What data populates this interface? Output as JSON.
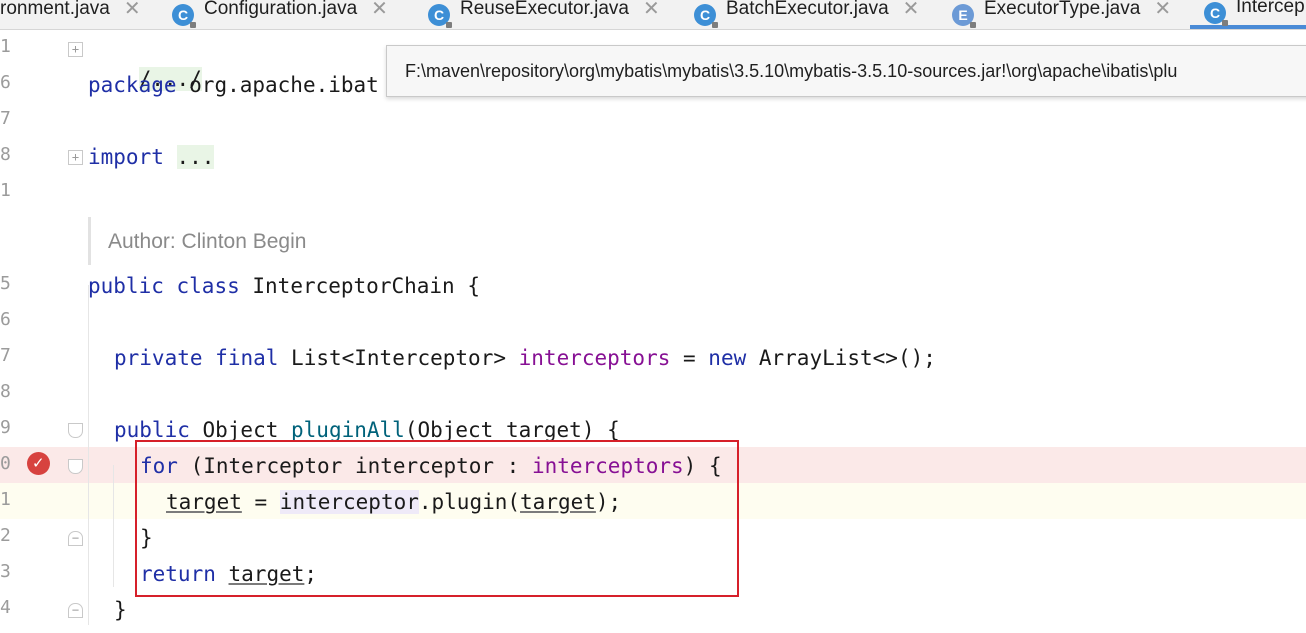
{
  "tabs": [
    {
      "badge": "",
      "label": "ronment.java",
      "active": false
    },
    {
      "badge": "C",
      "label": "Configuration.java",
      "active": false
    },
    {
      "badge": "C",
      "label": "ReuseExecutor.java",
      "active": false
    },
    {
      "badge": "C",
      "label": "BatchExecutor.java",
      "active": false
    },
    {
      "badge": "E",
      "label": "ExecutorType.java",
      "active": false
    },
    {
      "badge": "C",
      "label": "Intercep",
      "active": true
    }
  ],
  "close_glyph": "✕",
  "tooltip": {
    "path": "F:\\maven\\repository\\org\\mybatis\\mybatis\\3.5.10\\mybatis-3.5.10-sources.jar!\\org\\apache\\ibatis\\plu"
  },
  "line_numbers": [
    "1",
    "6",
    "7",
    "8",
    "1",
    "",
    "5",
    "6",
    "7",
    "8",
    "9",
    "0",
    "1",
    "2",
    "3",
    "4"
  ],
  "code": {
    "l1": "/.../",
    "l2_kw": "package",
    "l2_rest": " org.apache.ibat",
    "l4_kw": "import",
    "l4_rest": "...",
    "author": "Author: Clinton Begin",
    "l6_kw1": "public",
    "l6_kw2": "class",
    "l6_name": "InterceptorChain",
    "l6_brace": " {",
    "l8_kw1": "private",
    "l8_kw2": "final",
    "l8_type": "List<Interceptor>",
    "l8_field": "interceptors",
    "l8_eq": " = ",
    "l8_new": "new",
    "l8_rest": " ArrayList<>();",
    "l10_kw": "public",
    "l10_type": " Object ",
    "l10_meth": "pluginAll",
    "l10_rest": "(Object target) {",
    "l11_kw": "for",
    "l11_mid": " (Interceptor interceptor : ",
    "l11_field": "interceptors",
    "l11_end": ") {",
    "l12_var1": "target",
    "l12_eq": " = ",
    "l12_var2": "interceptor",
    "l12_rest": ".plugin(",
    "l12_var3": "target",
    "l12_end": ");",
    "l13": "}",
    "l14_kw": "return",
    "l14_var": "target",
    "l14_end": ";",
    "l15": "}"
  },
  "colors": {
    "keyword": "#1f2fa6",
    "field": "#871094",
    "method": "#00627a",
    "breakpoint_line": "#fbe9e8",
    "caret_line": "#fefdf0",
    "highlight_box": "#d6202a"
  }
}
